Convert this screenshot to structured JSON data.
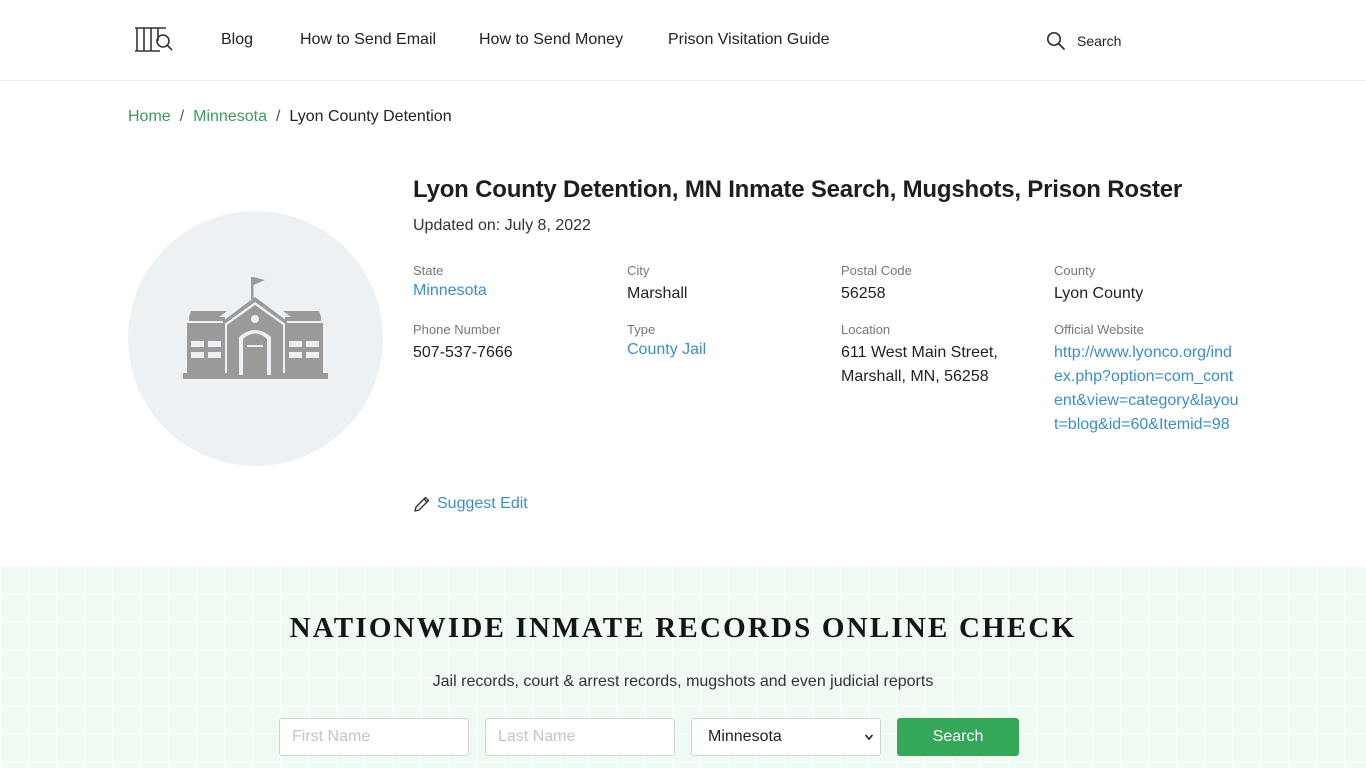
{
  "header": {
    "nav": [
      {
        "label": "Blog"
      },
      {
        "label": "How to Send Email"
      },
      {
        "label": "How to Send Money"
      },
      {
        "label": "Prison Visitation Guide"
      }
    ],
    "search_label": "Search"
  },
  "breadcrumb": {
    "home": "Home",
    "state": "Minnesota",
    "current": "Lyon County Detention",
    "separator": "/"
  },
  "facility": {
    "title": "Lyon County Detention, MN Inmate Search, Mugshots, Prison Roster",
    "updated": "Updated on: July 8, 2022",
    "fields": {
      "state": {
        "label": "State",
        "value": "Minnesota"
      },
      "city": {
        "label": "City",
        "value": "Marshall"
      },
      "postal": {
        "label": "Postal Code",
        "value": "56258"
      },
      "county": {
        "label": "County",
        "value": "Lyon County"
      },
      "phone": {
        "label": "Phone Number",
        "value": "507-537-7666"
      },
      "type": {
        "label": "Type",
        "value": "County Jail"
      },
      "location": {
        "label": "Location",
        "value": "611 West Main Street, Marshall, MN, 56258"
      },
      "website": {
        "label": "Official Website",
        "value": "http://www.lyonco.org/index.php?option=com_content&view=category&layout=blog&id=60&Itemid=98"
      }
    },
    "suggest_edit": "Suggest Edit",
    "icon": "school-building-icon"
  },
  "records": {
    "title": "NATIONWIDE INMATE RECORDS ONLINE CHECK",
    "subtitle": "Jail records, court & arrest records, mugshots and even judicial reports",
    "first_name_placeholder": "First Name",
    "last_name_placeholder": "Last Name",
    "state_selected": "Minnesota",
    "search_button": "Search"
  },
  "colors": {
    "link_green": "#3d9a5a",
    "link_blue": "#3b8fc4",
    "button_green": "#35a759",
    "section_bg": "#effaf3"
  }
}
